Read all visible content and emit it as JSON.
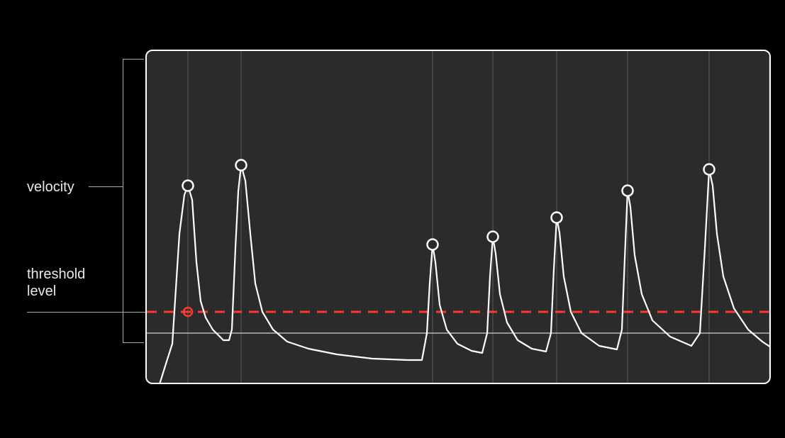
{
  "labels": {
    "velocity": "velocity",
    "threshold": "threshold\nlevel"
  },
  "colors": {
    "chart_bg": "#2b2b2b",
    "chart_border": "#ffffff",
    "grid_line": "#7a7a7a",
    "threshold_line": "#ff3b30",
    "baseline": "#c4c4c4",
    "curve": "#ffffff",
    "marker_stroke": "#ffffff",
    "marker_fill": "#2b2b2b",
    "threshold_circle_fill": "#ff3b30"
  },
  "chart_data": {
    "type": "line",
    "title": "",
    "xlabel": "",
    "ylabel": "velocity",
    "xlim": [
      0,
      882
    ],
    "ylim": [
      0,
      472
    ],
    "threshold_level_y": 370,
    "baseline_y": 400,
    "vertical_gridlines_x": [
      60,
      135,
      405,
      490,
      580,
      680,
      795,
      880
    ],
    "peak_markers": [
      {
        "x": 60,
        "y": 192
      },
      {
        "x": 135,
        "y": 163
      },
      {
        "x": 405,
        "y": 275
      },
      {
        "x": 490,
        "y": 264
      },
      {
        "x": 580,
        "y": 237
      },
      {
        "x": 680,
        "y": 199
      },
      {
        "x": 795,
        "y": 169
      }
    ],
    "threshold_crossing_marker": {
      "x": 60,
      "y": 370
    },
    "curve_points": [
      [
        0,
        472
      ],
      [
        20,
        472
      ],
      [
        30,
        440
      ],
      [
        38,
        415
      ],
      [
        48,
        260
      ],
      [
        55,
        205
      ],
      [
        60,
        192
      ],
      [
        66,
        212
      ],
      [
        72,
        300
      ],
      [
        78,
        355
      ],
      [
        85,
        378
      ],
      [
        95,
        395
      ],
      [
        105,
        405
      ],
      [
        110,
        410
      ],
      [
        118,
        410
      ],
      [
        122,
        395
      ],
      [
        127,
        280
      ],
      [
        131,
        200
      ],
      [
        135,
        163
      ],
      [
        141,
        185
      ],
      [
        148,
        260
      ],
      [
        155,
        330
      ],
      [
        165,
        370
      ],
      [
        180,
        395
      ],
      [
        200,
        412
      ],
      [
        230,
        422
      ],
      [
        270,
        430
      ],
      [
        320,
        436
      ],
      [
        370,
        438
      ],
      [
        390,
        438
      ],
      [
        397,
        400
      ],
      [
        401,
        330
      ],
      [
        405,
        275
      ],
      [
        409,
        300
      ],
      [
        415,
        360
      ],
      [
        425,
        395
      ],
      [
        440,
        415
      ],
      [
        460,
        425
      ],
      [
        475,
        428
      ],
      [
        482,
        400
      ],
      [
        486,
        320
      ],
      [
        490,
        264
      ],
      [
        494,
        288
      ],
      [
        500,
        345
      ],
      [
        510,
        385
      ],
      [
        525,
        410
      ],
      [
        545,
        422
      ],
      [
        565,
        426
      ],
      [
        572,
        400
      ],
      [
        576,
        310
      ],
      [
        580,
        237
      ],
      [
        584,
        258
      ],
      [
        590,
        320
      ],
      [
        600,
        370
      ],
      [
        615,
        400
      ],
      [
        640,
        418
      ],
      [
        665,
        423
      ],
      [
        672,
        395
      ],
      [
        676,
        295
      ],
      [
        680,
        199
      ],
      [
        684,
        222
      ],
      [
        690,
        290
      ],
      [
        700,
        345
      ],
      [
        715,
        382
      ],
      [
        740,
        405
      ],
      [
        770,
        418
      ],
      [
        782,
        400
      ],
      [
        789,
        280
      ],
      [
        795,
        169
      ],
      [
        800,
        192
      ],
      [
        806,
        260
      ],
      [
        815,
        320
      ],
      [
        830,
        365
      ],
      [
        850,
        395
      ],
      [
        870,
        412
      ],
      [
        882,
        420
      ]
    ]
  }
}
